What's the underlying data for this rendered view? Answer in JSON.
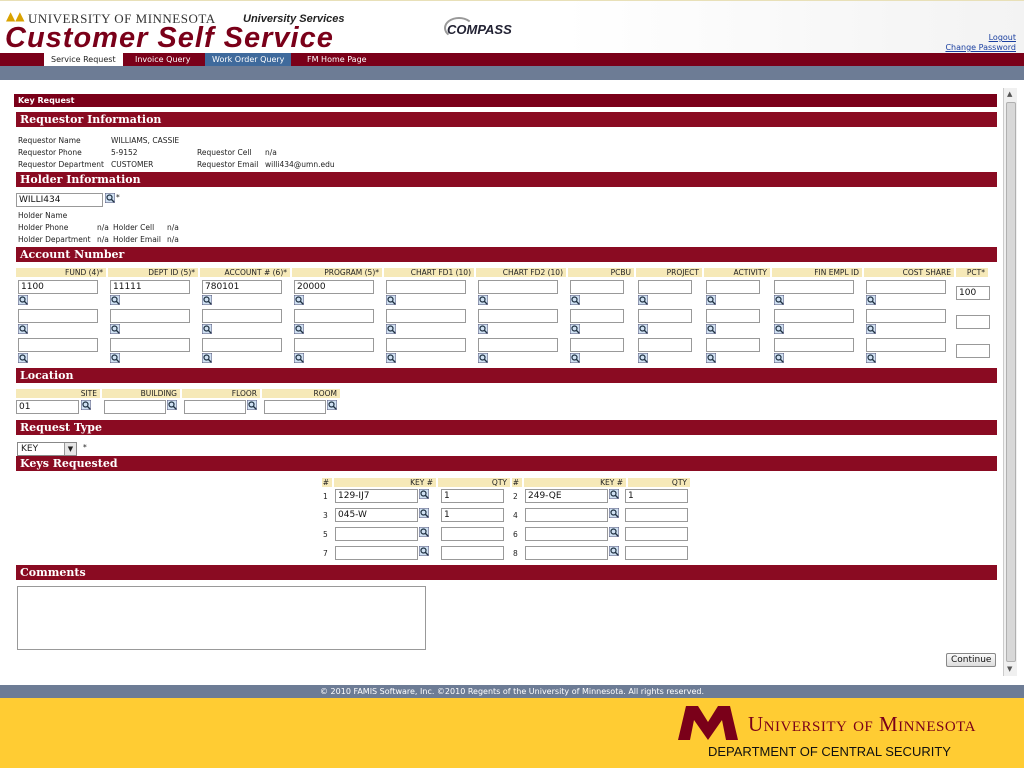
{
  "header": {
    "university": "University of Minnesota",
    "services": "University Services",
    "app_title": "Customer Self Service",
    "compass": "COMPASS",
    "logout": "Logout",
    "change_password": "Change Password"
  },
  "nav": {
    "tabs": [
      {
        "label": "Service Request"
      },
      {
        "label": "Invoice Query"
      },
      {
        "label": "Work Order Query"
      },
      {
        "label": "FM Home Page"
      }
    ]
  },
  "form": {
    "title": "Key Request",
    "requestor": {
      "heading": "Requestor Information",
      "name_label": "Requestor Name",
      "name": "WILLIAMS, CASSIE",
      "phone_label": "Requestor Phone",
      "phone": "5-9152",
      "cell_label": "Requestor Cell",
      "cell": "n/a",
      "dept_label": "Requestor Department",
      "dept": "CUSTOMER",
      "email_label": "Requestor Email",
      "email": "willi434@umn.edu"
    },
    "holder": {
      "heading": "Holder Information",
      "id_value": "WILLI434",
      "name_label": "Holder Name",
      "phone_label": "Holder Phone",
      "phone": "n/a",
      "cell_label": "Holder Cell",
      "cell": "n/a",
      "dept_label": "Holder Department",
      "dept": "n/a",
      "email_label": "Holder Email",
      "email": "n/a"
    },
    "account": {
      "heading": "Account Number",
      "columns": [
        "FUND (4)*",
        "DEPT ID (5)*",
        "ACCOUNT # (6)*",
        "PROGRAM (5)*",
        "CHART FD1 (10)",
        "CHART FD2 (10)",
        "PCBU",
        "PROJECT",
        "ACTIVITY",
        "FIN EMPL ID",
        "COST SHARE",
        "PCT*"
      ],
      "row1": {
        "fund": "1100",
        "dept": "11111",
        "account": "780101",
        "program": "20000",
        "pct": "100"
      }
    },
    "location": {
      "heading": "Location",
      "site_label": "SITE",
      "building_label": "BUILDING",
      "floor_label": "FLOOR",
      "room_label": "ROOM",
      "site": "01"
    },
    "request_type": {
      "heading": "Request Type",
      "selected": "KEY",
      "required_mark": "*"
    },
    "keys": {
      "heading": "Keys Requested",
      "col_num": "#",
      "col_key": "KEY #",
      "col_qty": "QTY",
      "rows": [
        {
          "n1": "1",
          "key1": "129-IJ7",
          "qty1": "1",
          "n2": "2",
          "key2": "249-QE",
          "qty2": "1"
        },
        {
          "n1": "3",
          "key1": "045-W",
          "qty1": "1",
          "n2": "4",
          "key2": "",
          "qty2": ""
        },
        {
          "n1": "5",
          "key1": "",
          "qty1": "",
          "n2": "6",
          "key2": "",
          "qty2": ""
        },
        {
          "n1": "7",
          "key1": "",
          "qty1": "",
          "n2": "8",
          "key2": "",
          "qty2": ""
        }
      ]
    },
    "comments": {
      "heading": "Comments"
    },
    "continue_label": "Continue"
  },
  "footer": {
    "copyright": "© 2010 FAMIS Software, Inc. ©2010 Regents of the University of Minnesota. All rights reserved.",
    "brand": "University of Minnesota",
    "department": "DEPARTMENT OF CENTRAL SECURITY"
  },
  "colors": {
    "maroon": "#7a0019",
    "gold": "#ffcc33",
    "slate": "#6d7c95"
  }
}
